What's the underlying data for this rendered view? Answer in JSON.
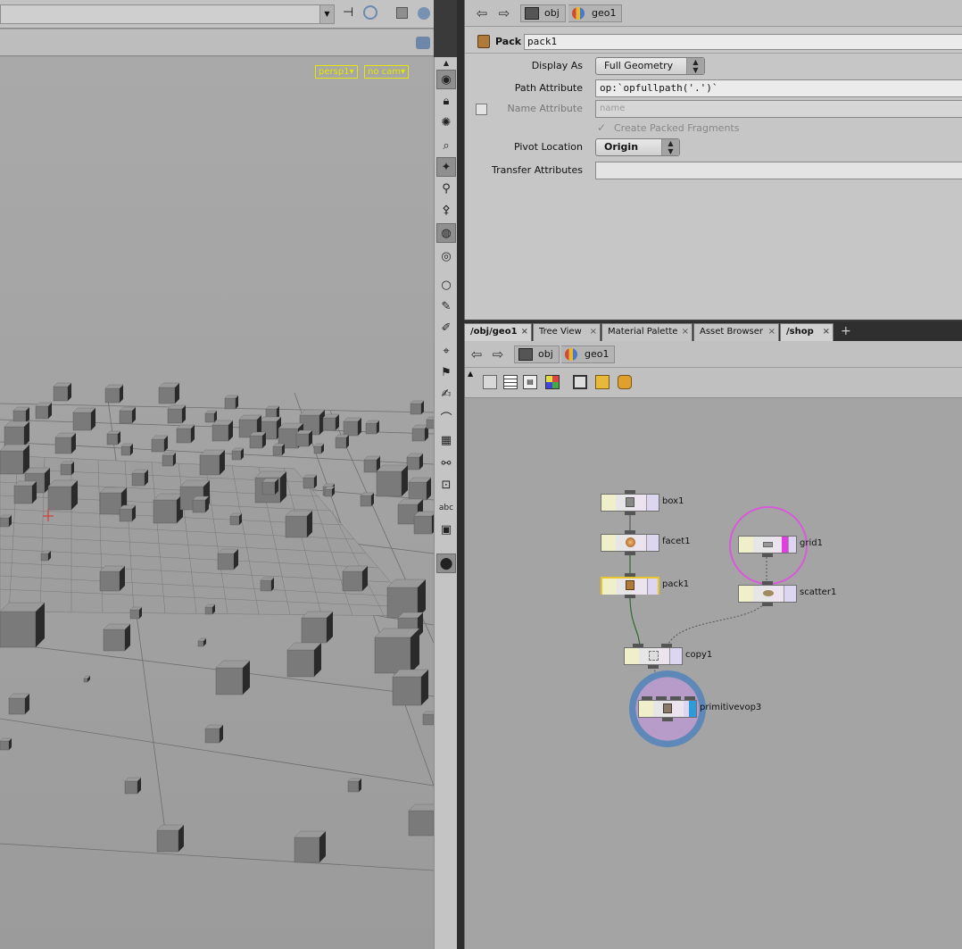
{
  "viewport": {
    "camera_label": "persp1▾",
    "display_label": "no cam▾",
    "accent_color": "#e6e600"
  },
  "param_pane": {
    "path": {
      "obj": "obj",
      "geo": "geo1"
    },
    "node_type": "Pack",
    "node_name": "pack1",
    "params": {
      "display_as_label": "Display As",
      "display_as_value": "Full Geometry",
      "path_attr_label": "Path Attribute",
      "path_attr_value": "op:`opfullpath('.')`",
      "name_attr_label": "Name Attribute",
      "name_attr_placeholder": "name",
      "create_fragments_label": "Create Packed Fragments",
      "pivot_label": "Pivot Location",
      "pivot_value": "Origin",
      "transfer_label": "Transfer Attributes",
      "transfer_value": ""
    }
  },
  "network_pane": {
    "tabs": [
      {
        "label": "/obj/geo1",
        "active": true
      },
      {
        "label": "Tree View",
        "active": false
      },
      {
        "label": "Material Palette",
        "active": false
      },
      {
        "label": "Asset Browser",
        "active": false
      },
      {
        "label": "/shop",
        "active": false
      }
    ],
    "add_tab": "+",
    "path": {
      "obj": "obj",
      "geo": "geo1"
    },
    "nodes": {
      "box1": "box1",
      "facet1": "facet1",
      "pack1": "pack1",
      "grid1": "grid1",
      "scatter1": "scatter1",
      "copy1": "copy1",
      "primitivevop3": "primitivevop3"
    }
  }
}
